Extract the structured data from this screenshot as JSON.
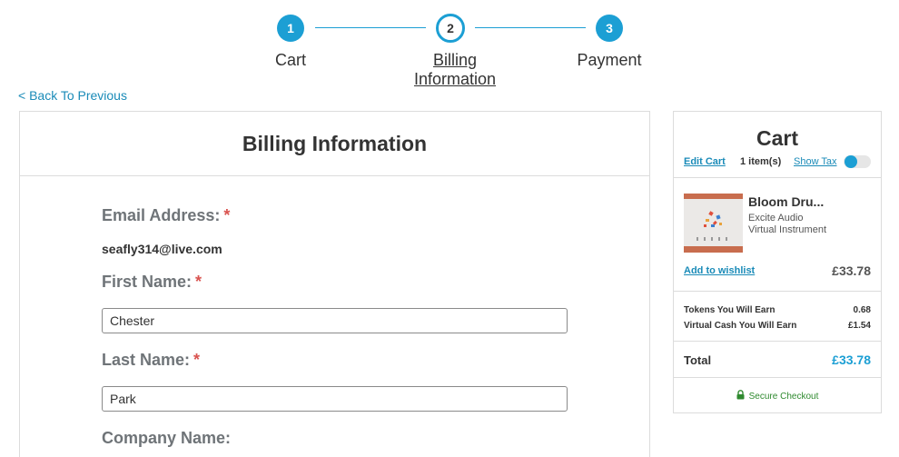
{
  "stepper": {
    "steps": [
      {
        "number": "1",
        "label": "Cart"
      },
      {
        "number": "2",
        "label_line1": "Billing",
        "label_line2": "Information"
      },
      {
        "number": "3",
        "label": "Payment"
      }
    ]
  },
  "back_link": "< Back To Previous",
  "billing": {
    "title": "Billing Information",
    "email_label": "Email Address:",
    "email_value": "seafly314@live.com",
    "first_name_label": "First Name:",
    "first_name_value": "Chester",
    "last_name_label": "Last Name:",
    "last_name_value": "Park",
    "company_label": "Company Name:",
    "required_mark": "*"
  },
  "cart": {
    "title": "Cart",
    "edit_cart": "Edit Cart",
    "items_count": "1 item(s)",
    "show_tax": "Show Tax",
    "product": {
      "name": "Bloom Dru...",
      "vendor": "Excite Audio",
      "type": "Virtual Instrument",
      "price": "£33.78"
    },
    "add_to_wishlist": "Add to wishlist",
    "tokens_label": "Tokens You Will Earn",
    "tokens_value": "0.68",
    "virtual_cash_label": "Virtual Cash You Will Earn",
    "virtual_cash_value": "£1.54",
    "total_label": "Total",
    "total_value": "£33.78",
    "secure_checkout": "Secure Checkout"
  },
  "colors": {
    "accent": "#1c9fd4",
    "link": "#1a8bb8",
    "required": "#d9534f",
    "secure": "#2f8a2f"
  }
}
